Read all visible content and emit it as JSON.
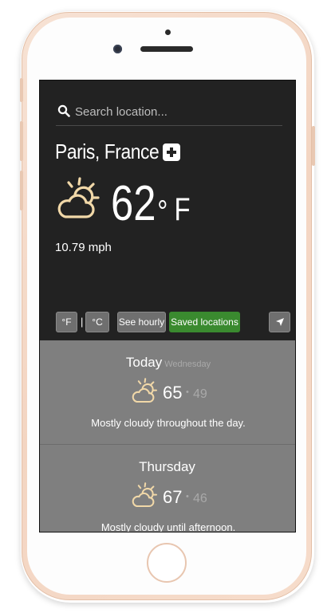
{
  "search": {
    "placeholder": "Search location..."
  },
  "location": {
    "name": "Paris, France"
  },
  "current": {
    "temp": "62",
    "degree": "°",
    "unit": "F",
    "wind": "10.79 mph",
    "icon": "partly-cloudy-icon"
  },
  "toolbar": {
    "fahrenheit_label": "°F",
    "separator": "|",
    "celsius_label": "°C",
    "hourly_label": "See hourly",
    "saved_label": "Saved locations",
    "locate_icon": "navigation-arrow-icon"
  },
  "forecast": [
    {
      "day": "Today",
      "weekday": "Wednesday",
      "high": "65",
      "low": "49",
      "summary": "Mostly cloudy throughout the day.",
      "icon": "partly-cloudy-icon"
    },
    {
      "day": "Thursday",
      "weekday": "",
      "high": "67",
      "low": "46",
      "summary": "Mostly cloudy until afternoon.",
      "icon": "partly-cloudy-icon"
    }
  ],
  "colors": {
    "screen_bg": "#222222",
    "forecast_bg": "#7f7f7f",
    "accent_green": "#3a8a2f",
    "icon_color": "#f1d8a8"
  }
}
